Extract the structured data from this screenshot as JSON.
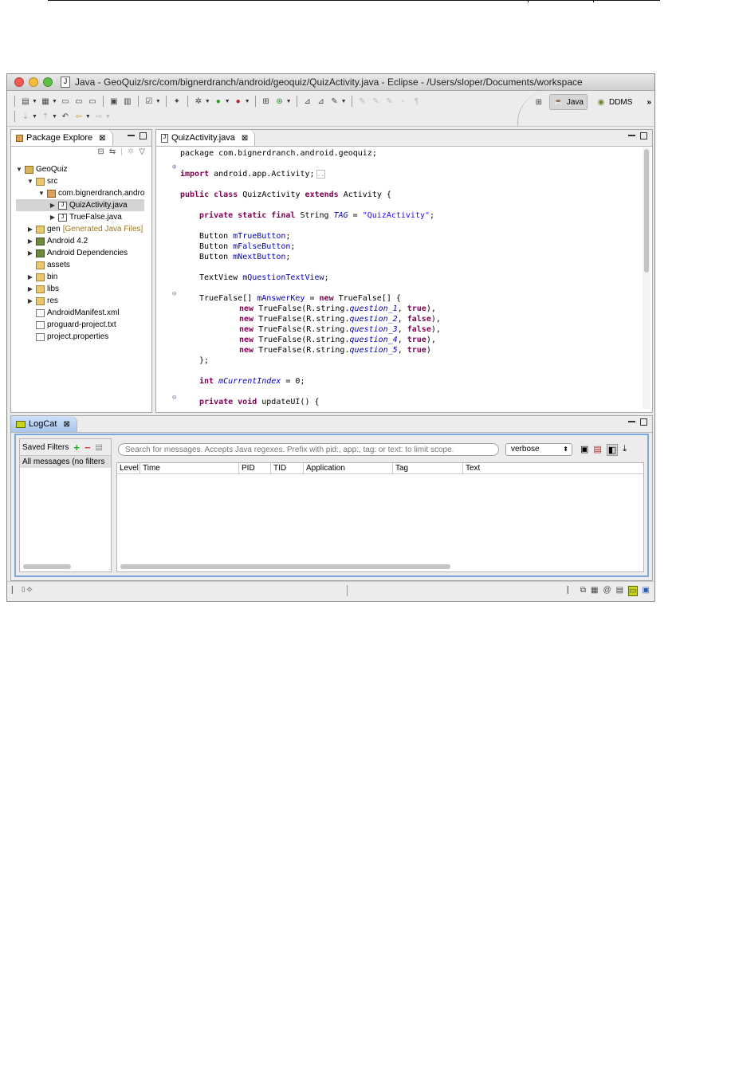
{
  "window": {
    "title": "Java - GeoQuiz/src/com/bignerdranch/android/geoquiz/QuizActivity.java - Eclipse - /Users/sloper/Documents/workspace"
  },
  "perspectives": {
    "java": "Java",
    "ddms": "DDMS",
    "more": "»"
  },
  "package_explorer": {
    "tab_label": "Package Explore",
    "tree": [
      {
        "label": "GeoQuiz",
        "level": 0,
        "twisty": "▼",
        "icon": "project-icon"
      },
      {
        "label": "src",
        "level": 1,
        "twisty": "▼",
        "icon": "source-folder-icon"
      },
      {
        "label": "com.bignerdranch.andro",
        "level": 2,
        "twisty": "▼",
        "icon": "package-icon"
      },
      {
        "label": "QuizActivity.java",
        "level": 3,
        "twisty": "▶",
        "icon": "java-file-icon",
        "selected": true
      },
      {
        "label": "TrueFalse.java",
        "level": 3,
        "twisty": "▶",
        "icon": "java-file-icon"
      },
      {
        "label": "gen",
        "note": " [Generated Java Files]",
        "level": 1,
        "twisty": "▶",
        "icon": "source-folder-icon"
      },
      {
        "label": "Android 4.2",
        "level": 1,
        "twisty": "▶",
        "icon": "library-icon"
      },
      {
        "label": "Android Dependencies",
        "level": 1,
        "twisty": "▶",
        "icon": "library-icon"
      },
      {
        "label": "assets",
        "level": 1,
        "twisty": "",
        "icon": "folder-icon"
      },
      {
        "label": "bin",
        "level": 1,
        "twisty": "▶",
        "icon": "folder-icon"
      },
      {
        "label": "libs",
        "level": 1,
        "twisty": "▶",
        "icon": "folder-icon"
      },
      {
        "label": "res",
        "level": 1,
        "twisty": "▶",
        "icon": "folder-icon"
      },
      {
        "label": "AndroidManifest.xml",
        "level": 1,
        "twisty": "",
        "icon": "file-icon"
      },
      {
        "label": "proguard-project.txt",
        "level": 1,
        "twisty": "",
        "icon": "file-icon"
      },
      {
        "label": "project.properties",
        "level": 1,
        "twisty": "",
        "icon": "file-icon"
      }
    ]
  },
  "editor": {
    "tab_label": "QuizActivity.java",
    "lines": {
      "l1": "package com.bignerdranch.android.geoquiz;",
      "l2_kw": "import",
      "l2_rest": " android.app.Activity;",
      "l3_kw1": "public class",
      "l3_name": " QuizActivity ",
      "l3_kw2": "extends",
      "l3_rest": " Activity {",
      "l4_kw": "private static final",
      "l4_type": " String ",
      "l4_field": "TAG",
      "l4_eq": " = ",
      "l4_str": "\"QuizActivity\"",
      "l4_end": ";",
      "l5_type": "Button ",
      "l5_field": "mTrueButton",
      "l6_field": "mFalseButton",
      "l7_field": "mNextButton",
      "semicolon": ";",
      "l8_type": "TextView ",
      "l8_field": "mQuestionTextView",
      "l9_type": "TrueFalse[] ",
      "l9_field": "mAnswerKey",
      "l9_eq": " = ",
      "l9_new": "new",
      "l9_rest": " TrueFalse[] {",
      "tf_new": "new",
      "tf_open": " TrueFalse(R.string.",
      "q1": "question_1",
      "q2": "question_2",
      "q3": "question_3",
      "q4": "question_4",
      "q5": "question_5",
      "comma_sp": ", ",
      "true": "true",
      "false": "false",
      "close_comma": "),",
      "close_last": ")",
      "l15": "};",
      "l16_kw": "int",
      "l16_field": " mCurrentIndex",
      "l16_rest": " = 0;",
      "l17_kw": "private void",
      "l17_rest": " updateUI() {"
    }
  },
  "logcat": {
    "tab_label": "LogCat",
    "saved_filters_label": "Saved Filters",
    "all_messages": "All messages (no filters",
    "search_placeholder": "Search for messages. Accepts Java regexes. Prefix with pid:, app:, tag: or text: to limit scope.",
    "level_value": "verbose",
    "columns": [
      "Level",
      "Time",
      "PID",
      "TID",
      "Application",
      "Tag",
      "Text"
    ]
  }
}
